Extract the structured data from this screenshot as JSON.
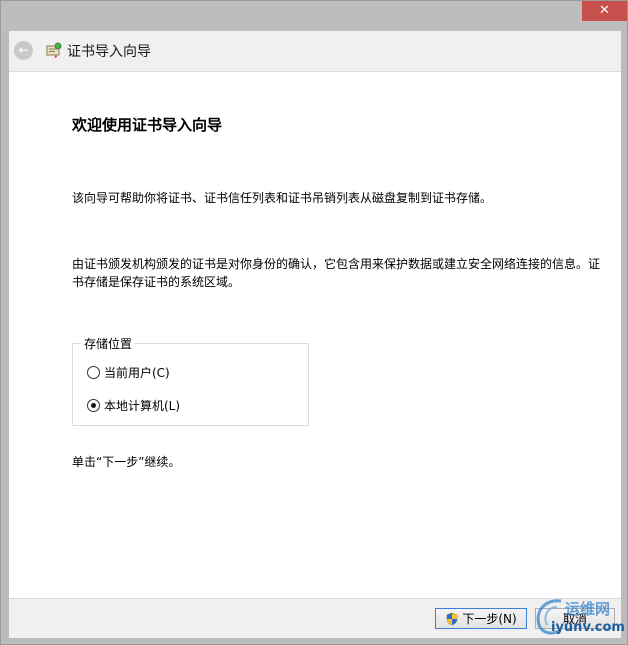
{
  "window": {
    "close_glyph": "✕"
  },
  "header": {
    "back_glyph": "←",
    "title": "证书导入向导"
  },
  "content": {
    "title": "欢迎使用证书导入向导",
    "para1": "该向导可帮助你将证书、证书信任列表和证书吊销列表从磁盘复制到证书存储。",
    "para2": "由证书颁发机构颁发的证书是对你身份的确认，它包含用来保护数据或建立安全网络连接的信息。证书存储是保存证书的系统区域。",
    "store_location": {
      "legend": "存储位置",
      "options": [
        {
          "label": "当前用户(C)",
          "selected": false
        },
        {
          "label": "本地计算机(L)",
          "selected": true
        }
      ]
    },
    "continue_text": "单击“下一步”继续。"
  },
  "footer": {
    "next_label": "下一步(N)",
    "cancel_label": "取消"
  },
  "watermark": {
    "brand": "运维网",
    "url": "iyunv.com"
  },
  "colors": {
    "accent": "#3c7fd8",
    "close": "#c7504c",
    "watermark": "#2a7cc9"
  }
}
